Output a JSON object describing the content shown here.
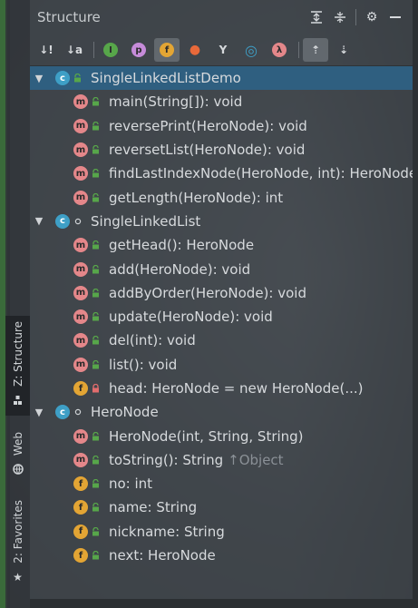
{
  "panel": {
    "title": "Structure",
    "title_actions": [
      "expand-all-icon",
      "collapse-all-icon",
      "gear-icon",
      "minimize-icon"
    ]
  },
  "toolbar": {
    "tools": [
      {
        "name": "sort-by-visibility-icon",
        "glyph": "↓!",
        "on": false
      },
      {
        "name": "sort-alphabetically-icon",
        "glyph": "↓a",
        "on": false
      },
      {
        "name": "show-inherited-icon",
        "glyph": "I",
        "on": false
      },
      {
        "name": "show-properties-icon",
        "glyph": "p",
        "on": false
      },
      {
        "name": "show-fields-icon",
        "glyph": "f",
        "on": true
      },
      {
        "name": "show-non-public-icon",
        "glyph": "●",
        "on": false
      },
      {
        "name": "show-lambdas-icon",
        "glyph": "Y",
        "on": false
      },
      {
        "name": "show-anonymous-icon",
        "glyph": "◎",
        "on": false
      },
      {
        "name": "show-lambda-icon",
        "glyph": "λ",
        "on": false
      },
      {
        "name": "autoscroll-to-source-icon",
        "glyph": "⇡",
        "on": true
      },
      {
        "name": "autoscroll-from-source-icon",
        "glyph": "⇣",
        "on": false
      }
    ]
  },
  "sidebar": {
    "tabs": [
      {
        "label": "Z: Structure",
        "icon": "structure-icon",
        "active": true
      },
      {
        "label": "Web",
        "icon": "web-icon",
        "active": false
      },
      {
        "label": "2: Favorites",
        "icon": "star-icon",
        "active": false
      }
    ]
  },
  "tree": [
    {
      "level": 0,
      "kind": "c",
      "visibility": "public",
      "label": "SingleLinkedListDemo",
      "expanded": true,
      "selected": true
    },
    {
      "level": 1,
      "kind": "m",
      "visibility": "public",
      "label": "main(String[]): void"
    },
    {
      "level": 1,
      "kind": "m",
      "visibility": "public",
      "label": "reversePrint(HeroNode): void"
    },
    {
      "level": 1,
      "kind": "m",
      "visibility": "public",
      "label": "reversetList(HeroNode): void"
    },
    {
      "level": 1,
      "kind": "m",
      "visibility": "public",
      "label": "findLastIndexNode(HeroNode, int): HeroNode"
    },
    {
      "level": 1,
      "kind": "m",
      "visibility": "public",
      "label": "getLength(HeroNode): int"
    },
    {
      "level": 0,
      "kind": "c",
      "visibility": "package",
      "label": "SingleLinkedList",
      "expanded": true
    },
    {
      "level": 1,
      "kind": "m",
      "visibility": "public",
      "label": "getHead(): HeroNode"
    },
    {
      "level": 1,
      "kind": "m",
      "visibility": "public",
      "label": "add(HeroNode): void"
    },
    {
      "level": 1,
      "kind": "m",
      "visibility": "public",
      "label": "addByOrder(HeroNode): void"
    },
    {
      "level": 1,
      "kind": "m",
      "visibility": "public",
      "label": "update(HeroNode): void"
    },
    {
      "level": 1,
      "kind": "m",
      "visibility": "public",
      "label": "del(int): void"
    },
    {
      "level": 1,
      "kind": "m",
      "visibility": "public",
      "label": "list(): void"
    },
    {
      "level": 1,
      "kind": "f",
      "visibility": "private",
      "label": "head: HeroNode = new HeroNode(...)"
    },
    {
      "level": 0,
      "kind": "c",
      "visibility": "package",
      "label": "HeroNode",
      "expanded": true
    },
    {
      "level": 1,
      "kind": "m",
      "visibility": "public",
      "label": "HeroNode(int, String, String)"
    },
    {
      "level": 1,
      "kind": "m",
      "visibility": "public",
      "label": "toString(): String",
      "suffix": "↑Object"
    },
    {
      "level": 1,
      "kind": "f",
      "visibility": "public",
      "label": "no: int"
    },
    {
      "level": 1,
      "kind": "f",
      "visibility": "public",
      "label": "name: String"
    },
    {
      "level": 1,
      "kind": "f",
      "visibility": "public",
      "label": "nickname: String"
    },
    {
      "level": 1,
      "kind": "f",
      "visibility": "public",
      "label": "next: HeroNode"
    }
  ],
  "colors": {
    "selection": "#2f5f80",
    "method_badge": "#e4878a",
    "field_badge": "#e3a534",
    "class_badge": "#3e9fc6",
    "public_lock": "#57a64a"
  }
}
